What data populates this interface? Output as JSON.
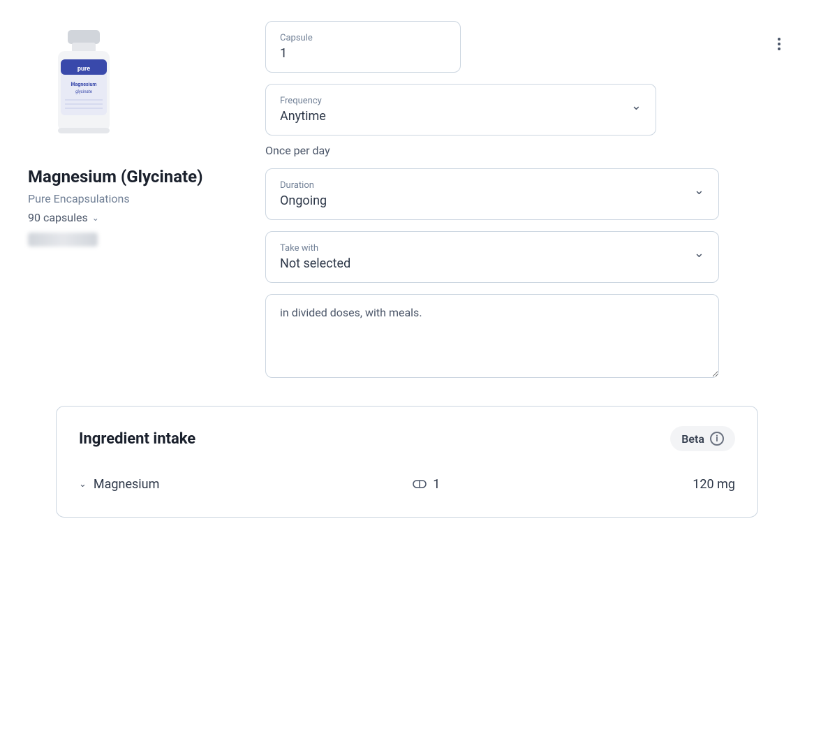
{
  "product": {
    "name": "Magnesium (Glycinate)",
    "brand": "Pure Encapsulations",
    "quantity": "90 capsules"
  },
  "capsule": {
    "label": "Capsule",
    "value": "1"
  },
  "frequency": {
    "label": "Frequency",
    "value": "Anytime"
  },
  "once_per_day": "Once per day",
  "duration": {
    "label": "Duration",
    "value": "Ongoing"
  },
  "take_with": {
    "label": "Take with",
    "value": "Not selected"
  },
  "notes": {
    "placeholder": "in divided doses, with meals.",
    "value": "in divided doses, with meals."
  },
  "ingredient_intake": {
    "title": "Ingredient intake",
    "beta_label": "Beta",
    "items": [
      {
        "name": "Magnesium",
        "capsule_count": "1",
        "amount": "120 mg"
      }
    ]
  },
  "three_dots_label": "⋮"
}
